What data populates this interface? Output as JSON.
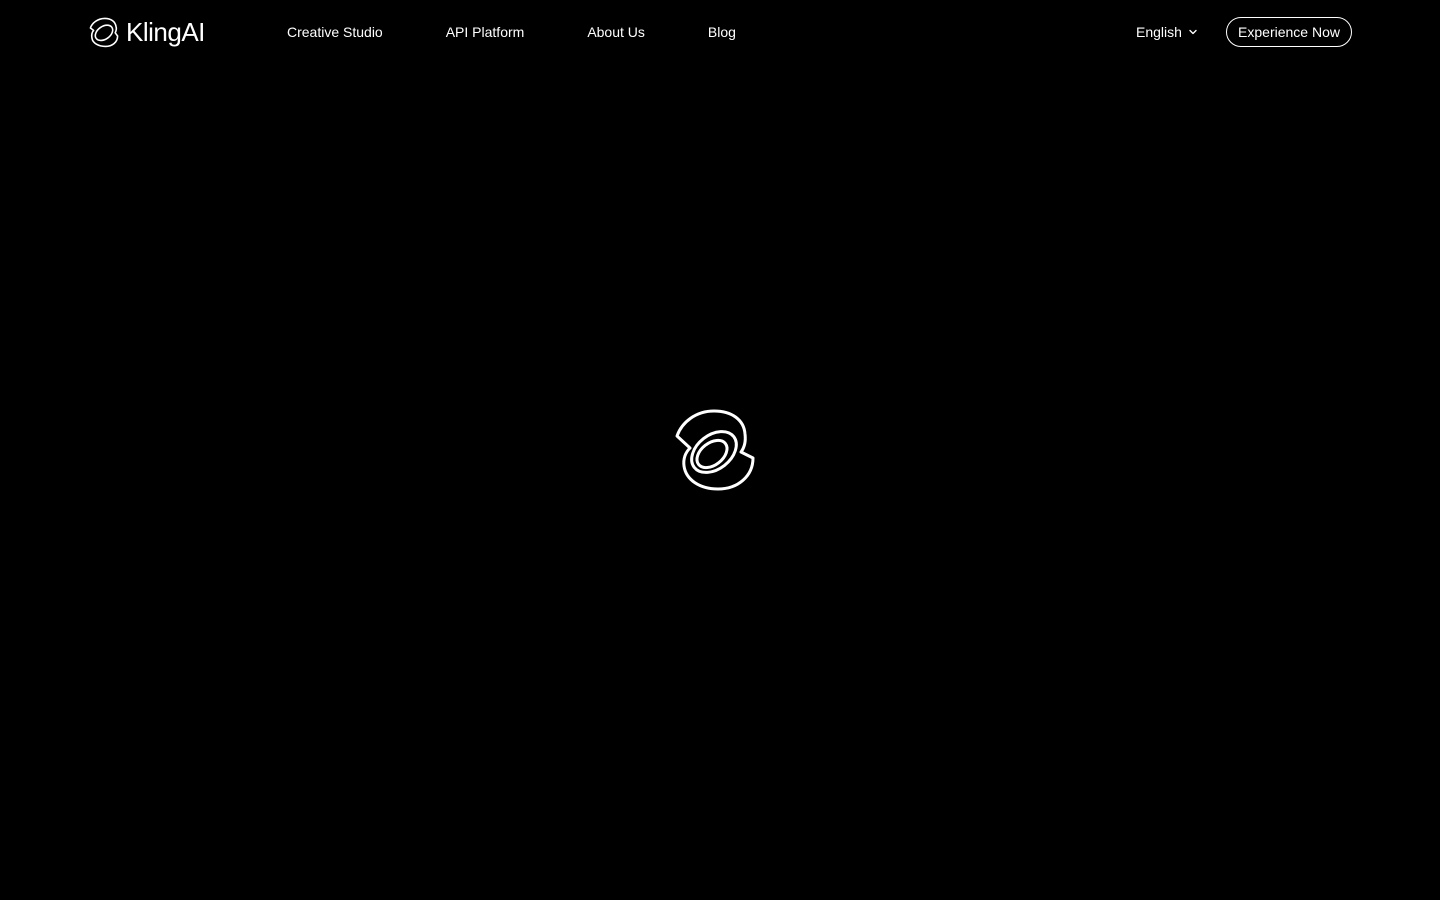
{
  "header": {
    "brand_name": "KlingAI",
    "nav": [
      {
        "label": "Creative Studio"
      },
      {
        "label": "API Platform"
      },
      {
        "label": "About Us"
      },
      {
        "label": "Blog"
      }
    ],
    "language": {
      "selected": "English",
      "icon": "chevron-down-icon"
    },
    "cta_label": "Experience Now"
  },
  "main": {
    "loader_icon": "klingai-logo-icon"
  },
  "colors": {
    "background": "#000000",
    "foreground": "#ffffff"
  }
}
